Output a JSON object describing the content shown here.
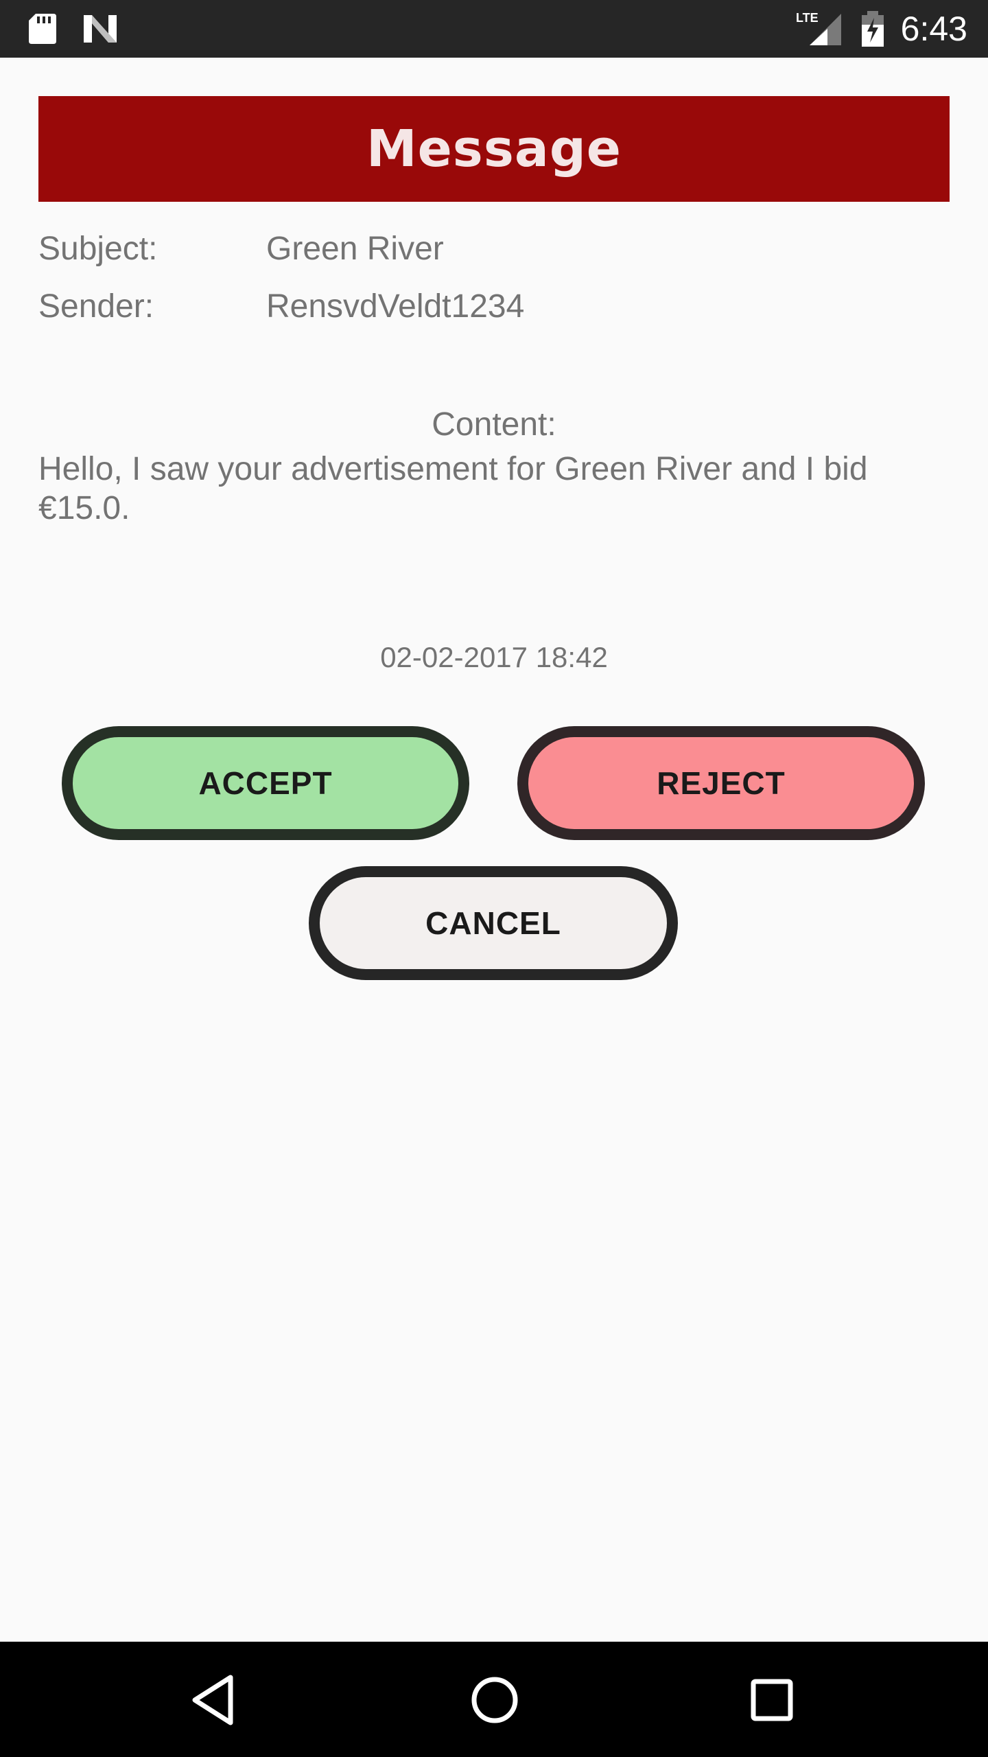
{
  "status_bar": {
    "time": "6:43",
    "network": "LTE",
    "icons": [
      "sd-card-icon",
      "n-logo-icon",
      "lte-signal-icon",
      "battery-charging-icon"
    ]
  },
  "header": {
    "title": "Message",
    "background_color": "#990909"
  },
  "message": {
    "subject_label": "Subject:",
    "subject_value": "Green River",
    "sender_label": "Sender:",
    "sender_value": "RensvdVeldt1234",
    "content_label": "Content:",
    "content_text": "Hello, I saw your advertisement for Green River and I bid €15.0.",
    "timestamp": "02-02-2017 18:42"
  },
  "actions": {
    "accept_label": "ACCEPT",
    "reject_label": "REJECT",
    "cancel_label": "CANCEL",
    "accept_color": "#a3e2a3",
    "reject_color": "#fa8d92",
    "cancel_color": "#f3f0ef"
  },
  "nav_bar": {
    "icons": [
      "back-icon",
      "home-icon",
      "recents-icon"
    ]
  }
}
